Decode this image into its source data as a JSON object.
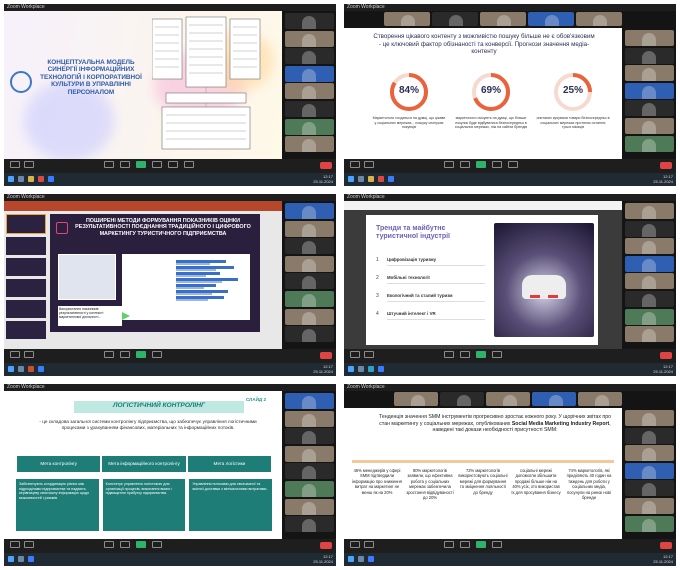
{
  "zoom": {
    "meeting_label": "Zoom Workplace",
    "view_label": "Вигляд",
    "clock_time": "12:17",
    "clock_date": "25.11.2024"
  },
  "slide1": {
    "title": "КОНЦЕПТУАЛЬНА МОДЕЛЬ СИНЕРГІЇ ІНФОРМАЦІЙНИХ ТЕХНОЛОГІЙ І КОРПОРАТИВНОЇ КУЛЬТУРИ В УПРАВЛІННІ ПЕРСОНАЛОМ"
  },
  "slide2": {
    "headline": "Створення цікавого контенту з можливістю пошуку більше не є обов'язковим - це ключовий фактор обізнаності та конверсії. Прогнози значення медіа-контенту",
    "stats": [
      {
        "value": "84%",
        "caption": "Маркетологи сходяться на думці, що цікаве у соціальних мережах... пошуку спонукає покупців"
      },
      {
        "value": "69%",
        "caption": "маркетологи очікують на думці, що більше покупок буде відбуватися безпосередньо в соціальних мережах, ніж на сайтах брендів"
      },
      {
        "value": "25%",
        "caption": "опитаних купували товари безпосередньо в соціальних мережах протягом останніх трьох місяців"
      }
    ],
    "accent": "#e8643c"
  },
  "slide3": {
    "title": "ПОШИРЕНІ МЕТОДИ ФОРМУВАННЯ ПОКАЗНИКІВ ОЦІНКИ РЕЗУЛЬТАТИВНОСТІ ПОЄДНАННЯ ТРАДИЦІЙНОГО І ЦИФРОВОГО МАРКЕТИНГУ ТУРИСТИЧНОГО ПІДПРИЄМСТВА",
    "note": "Використання показників результативності у контексті маркетингової діяльності..."
  },
  "slide4": {
    "title": "Тренди та майбутнє туристичної індустрії",
    "items": [
      {
        "num": "1",
        "label": "Цифровізація туризму"
      },
      {
        "num": "2",
        "label": "Мобільні технології"
      },
      {
        "num": "3",
        "label": "Екологічний та сталий туризм"
      },
      {
        "num": "4",
        "label": "Штучний інтелект і VR"
      }
    ]
  },
  "slide5": {
    "slide_no": "СЛАЙД 2",
    "title": "ЛОГІСТИЧНИЙ КОНТРОЛІНГ",
    "intro": "- це складова загальної системи контролінгу підприємства, що забезпечує управління логістичними процесами з урахуванням фінансових, матеріальних та інформаційних потоків.",
    "goals": [
      "Мета контролінгу",
      "Мета інформаційного контролінгу",
      "Мета логістики"
    ],
    "bottom": [
      "Забезпечують координацію різних між підрозділами підприємства та надають керівництву своєчасну інформацію щодо можливостей і ризиків.",
      "Констатує управління логістикою для організації процесів, виконання вимог і підвищення прибутку підприємства.",
      "Управління потоками для своєчасної та якісної доставки з мінімальними витратами."
    ]
  },
  "slide6": {
    "text": "Тенденція значення SMM інструментів прогресивно зростає кожного року. У щорічних звітах про стан маркетингу у соціальних мережах, опублікованих Social Media Marketing Industry Report, наведені такі докази необхідності присутності SMM:",
    "highlight": "Social Media Marketing Industry Report",
    "columns": [
      "46% менеджерів у сфері SMM підтвердили інформацію про зниження витрат на маркетинг не менш як на 20%",
      "80% маркетологів заявили, що ефективна робота у соціальних мережах забезпечила зростання відвідуваності до 20%",
      "72% маркетологів використовують соціальні мережі для формування та зміцнення лояльності до бренду",
      "соціальні мережі допомогли збільшити продажі більше ніж на 40% усіх, хто використав їх для просування бізнесу",
      "74% маркетологів, які приділяють 40 годин на тиждень для роботи у соціальних медіа, посунули на ринок нові бренди"
    ]
  }
}
